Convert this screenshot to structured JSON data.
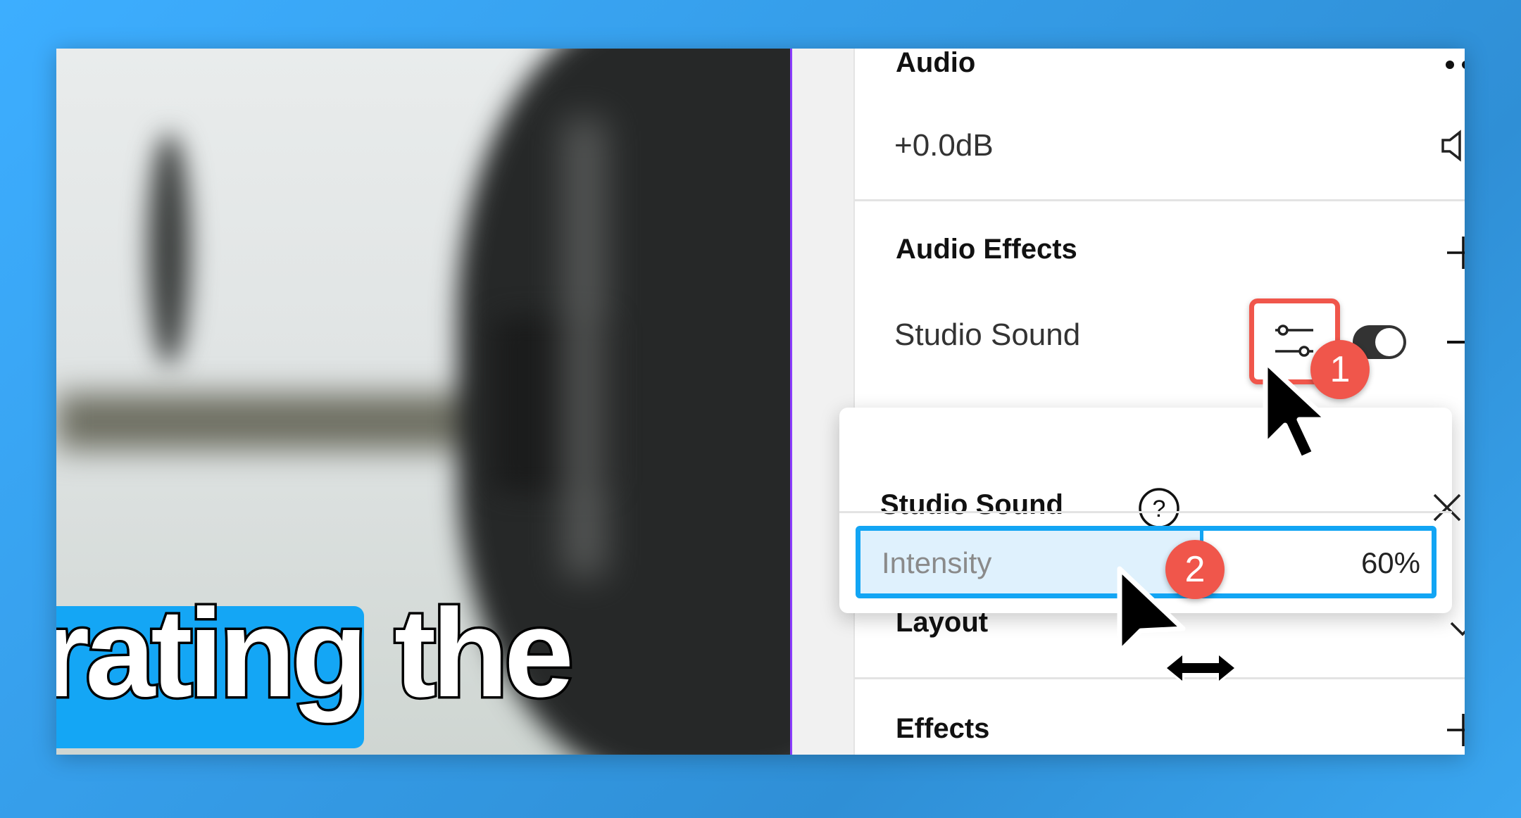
{
  "video": {
    "caption": "rating the",
    "caption_highlight_color": "#14a6f5"
  },
  "panel": {
    "audio": {
      "title": "Audio",
      "more_icon": "more-horizontal-icon",
      "volume": "+0.0dB",
      "volume_icon": "speaker-icon"
    },
    "audio_effects": {
      "title": "Audio Effects",
      "add_icon": "plus-icon",
      "items": [
        {
          "label": "Studio Sound",
          "settings_icon": "sliders-icon",
          "enabled": true,
          "remove_icon": "minus-icon"
        }
      ]
    },
    "layout": {
      "title": "Layout",
      "icon": "chevron-down-icon"
    },
    "effects": {
      "title": "Effects",
      "add_icon": "plus-icon"
    }
  },
  "popup": {
    "title": "Studio Sound",
    "help_icon": "question-circle-icon",
    "close_icon": "close-icon",
    "intensity": {
      "label": "Intensity",
      "value": "60%",
      "fraction": 0.6
    }
  },
  "annotations": {
    "step1": "1",
    "step2": "2",
    "highlight_color": "#f0564b"
  }
}
